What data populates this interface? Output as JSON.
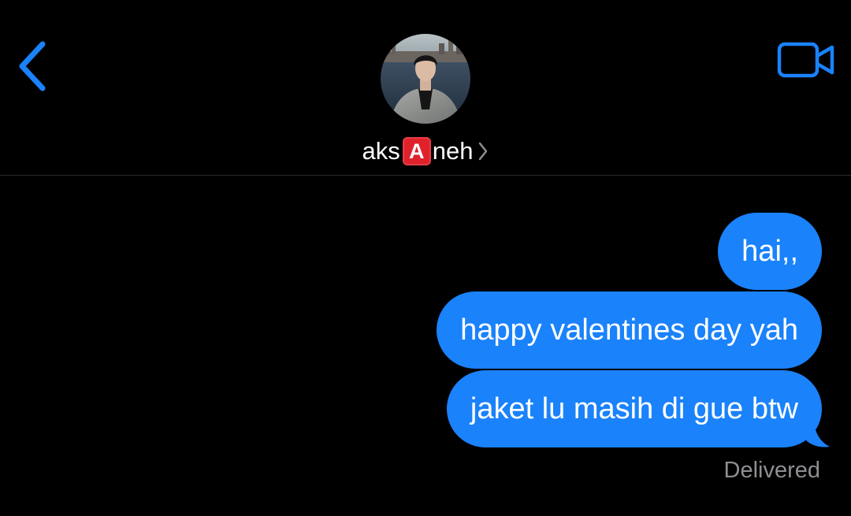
{
  "colors": {
    "background": "#000000",
    "accent": "#1a82fb",
    "bubble": "#1a82fb",
    "delivered_text": "#8e8e93",
    "letter_badge": "#e0212c"
  },
  "header": {
    "back_icon": "chevron-left-icon",
    "video_icon": "video-camera-icon",
    "avatar_icon": "contact-avatar-photo",
    "contact": {
      "name_prefix": "aks",
      "name_badge_letter": "A",
      "name_suffix": "neh",
      "chevron_icon": "chevron-right-icon"
    }
  },
  "messages": [
    {
      "text": "hai,,",
      "direction": "outgoing"
    },
    {
      "text": "happy valentines day yah",
      "direction": "outgoing"
    },
    {
      "text": "jaket lu masih di gue btw",
      "direction": "outgoing"
    }
  ],
  "status": {
    "delivered": "Delivered"
  }
}
